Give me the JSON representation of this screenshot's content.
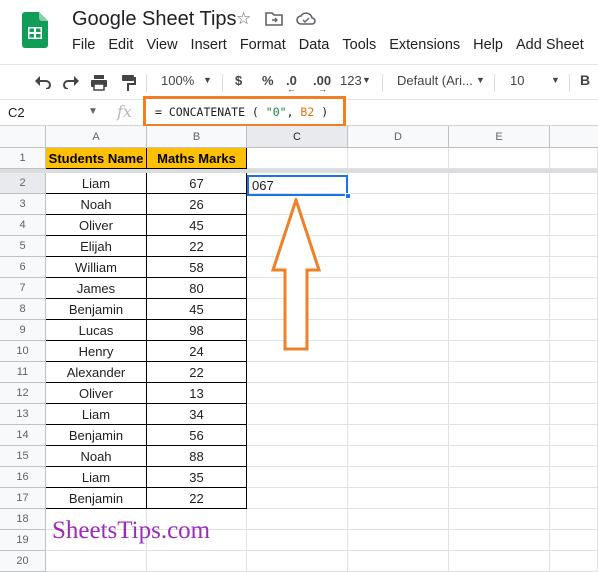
{
  "app": {
    "title": "Google Sheet Tips"
  },
  "menu": [
    "File",
    "Edit",
    "View",
    "Insert",
    "Format",
    "Data",
    "Tools",
    "Extensions",
    "Help",
    "Add Sheet"
  ],
  "toolbar": {
    "zoom": "100%",
    "currency": "$",
    "percent": "%",
    "dec_decrease": ".0",
    "dec_increase": ".00",
    "more_formats": "123",
    "font": "Default (Ari...",
    "font_size": "10",
    "bold": "B"
  },
  "formula_bar": {
    "name_box": "C2",
    "fx": "fx",
    "formula_eq": "= CONCATENATE ( ",
    "formula_str": "\"0\"",
    "formula_comma": ", ",
    "formula_ref": "B2",
    "formula_close": " )"
  },
  "columns": [
    "A",
    "B",
    "C",
    "D",
    "E"
  ],
  "headers": {
    "col_a": "Students Name",
    "col_b": "Maths Marks"
  },
  "rows": [
    {
      "name": "Liam",
      "marks": "67"
    },
    {
      "name": "Noah",
      "marks": "26"
    },
    {
      "name": "Oliver",
      "marks": "45"
    },
    {
      "name": "Elijah",
      "marks": "22"
    },
    {
      "name": "William",
      "marks": "58"
    },
    {
      "name": "James",
      "marks": "80"
    },
    {
      "name": "Benjamin",
      "marks": "45"
    },
    {
      "name": "Lucas",
      "marks": "98"
    },
    {
      "name": "Henry",
      "marks": "24"
    },
    {
      "name": "Alexander",
      "marks": "22"
    },
    {
      "name": "Oliver",
      "marks": "13"
    },
    {
      "name": "Liam",
      "marks": "34"
    },
    {
      "name": "Benjamin",
      "marks": "56"
    },
    {
      "name": "Noah",
      "marks": "88"
    },
    {
      "name": "Liam",
      "marks": "35"
    },
    {
      "name": "Benjamin",
      "marks": "22"
    }
  ],
  "row_numbers": [
    "1",
    "2",
    "3",
    "4",
    "5",
    "6",
    "7",
    "8",
    "9",
    "10",
    "11",
    "12",
    "13",
    "14",
    "15",
    "16",
    "17",
    "18",
    "19",
    "20"
  ],
  "result_cell": "067",
  "watermark": "SheetsTips.com",
  "colors": {
    "annotation": "#f07f25",
    "header_fill": "#ffc000",
    "selection": "#1a73e8",
    "watermark": "#9c2bbd"
  }
}
